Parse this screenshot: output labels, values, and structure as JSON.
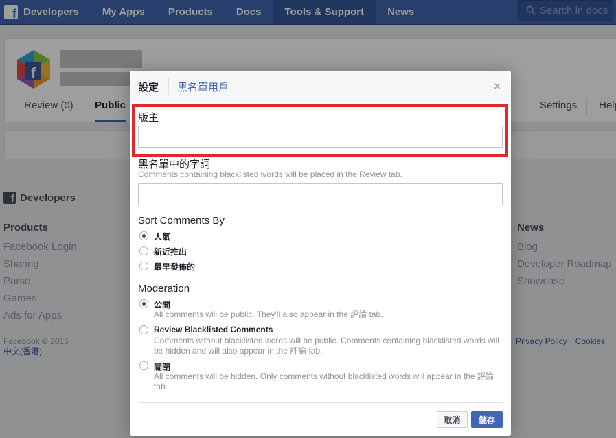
{
  "nav": {
    "brand": "Developers",
    "items": [
      "My Apps",
      "Products",
      "Docs",
      "Tools & Support",
      "News"
    ],
    "active": "Tools & Support",
    "search_placeholder": "Search in docs"
  },
  "app": {
    "tabs": [
      "Review (0)",
      "Public",
      "Settings",
      "Help"
    ]
  },
  "footer": {
    "brand": "Developers",
    "products": {
      "heading": "Products",
      "items": [
        "Facebook Login",
        "Sharing",
        "Parse",
        "Games",
        "Ads for Apps"
      ]
    },
    "news": {
      "heading": "News",
      "items": [
        "Blog",
        "Developer Roadmap",
        "Showcase"
      ]
    },
    "copyright": "Facebook © 2015",
    "language": "中文(香港)",
    "links": [
      "Privacy Policy",
      "Cookies"
    ]
  },
  "dialog": {
    "tabs": [
      "設定",
      "黑名單用戶"
    ],
    "close": "×",
    "moderators_label": "版主",
    "blacklist_label": "黑名單中的字詞",
    "blacklist_hint": "Comments containing blacklisted words will be placed in the Review tab.",
    "sort": {
      "label": "Sort Comments By",
      "options": [
        "人氣",
        "新近推出",
        "最早發佈的"
      ],
      "selected": "人氣"
    },
    "moderation": {
      "label": "Moderation",
      "options": [
        {
          "label": "公開",
          "desc": "All comments will be public. They'll also appear in the 評論 tab."
        },
        {
          "label": "Review Blacklisted Comments",
          "desc": "Comments without blacklisted words will be public. Comments containing blacklisted words will be hidden and will also appear in the 評論 tab."
        },
        {
          "label": "關閉",
          "desc": "All comments will be hidden. Only comments without blacklisted words will appear in the 評論 tab."
        }
      ],
      "selected": "公開"
    },
    "cancel": "取消",
    "save": "儲存"
  },
  "colors": {
    "brand": "#4267b2",
    "highlight": "#dd2a30"
  }
}
